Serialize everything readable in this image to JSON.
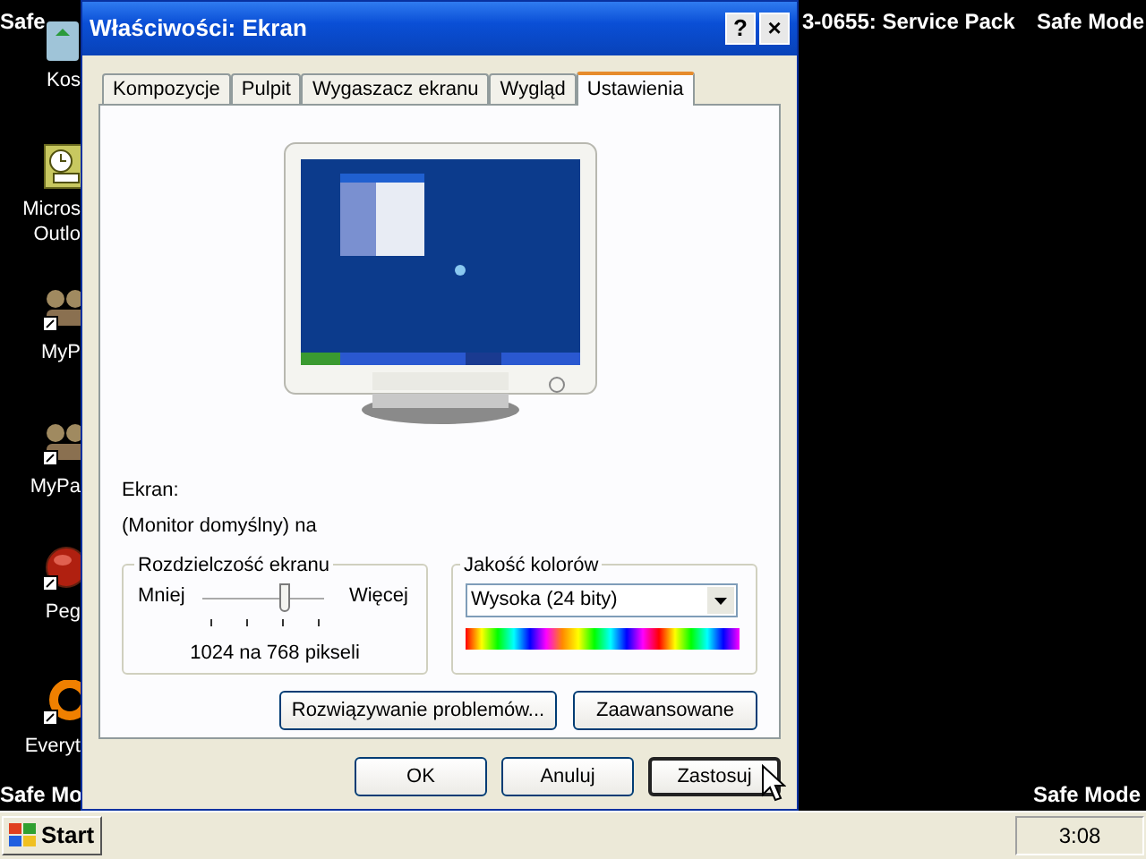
{
  "desktop": {
    "icons": [
      {
        "kind": "bin",
        "lines": [
          "Kos"
        ]
      },
      {
        "kind": "clock",
        "lines": [
          "Micros",
          "Outlo"
        ]
      },
      {
        "kind": "figures",
        "lines": [
          "MyP"
        ]
      },
      {
        "kind": "figures",
        "lines": [
          "MyPa"
        ]
      },
      {
        "kind": "ball",
        "lines": [
          "Peg"
        ]
      },
      {
        "kind": "ring",
        "lines": [
          "Everyt"
        ]
      }
    ],
    "overlay_texts": [
      {
        "kind": "top_left",
        "text": "Safe"
      },
      {
        "kind": "top_right",
        "text": "3-0655: Service Pack"
      },
      {
        "kind": "top_corner",
        "text": "Safe Mode"
      },
      {
        "kind": "bottom_left",
        "text": "Safe Mo"
      },
      {
        "kind": "bottom_right",
        "text": "Safe Mode"
      }
    ]
  },
  "window": {
    "title": "Właściwości: Ekran",
    "title_buttons": [
      "?",
      "×"
    ]
  },
  "tabs": [
    {
      "label": "Kompozycje",
      "selected": false
    },
    {
      "label": "Pulpit",
      "selected": false
    },
    {
      "label": "Wygaszacz ekranu",
      "selected": false
    },
    {
      "label": "Wygląd",
      "selected": false
    },
    {
      "label": "Ustawienia",
      "selected": true
    }
  ],
  "display": {
    "label": "Ekran:",
    "value": "(Monitor domyślny) na"
  },
  "resolution": {
    "title": "Rozdzielczość ekranu",
    "min_label": "Mniej",
    "max_label": "Więcej",
    "level": 0.67,
    "reading": "1024 na 768 pikseli"
  },
  "color_quality": {
    "title": "Jakość kolorów",
    "value": "Wysoka (24 bity)"
  },
  "panel_buttons": [
    "Rozwiązywanie problemów...",
    "Zaawansowane"
  ],
  "dialog_buttons": [
    {
      "label": "OK",
      "focused": false
    },
    {
      "label": "Anuluj",
      "focused": false
    },
    {
      "label": "Zastosuj",
      "focused": true
    }
  ],
  "taskbar": {
    "start": "Start",
    "clock": "3:08"
  }
}
